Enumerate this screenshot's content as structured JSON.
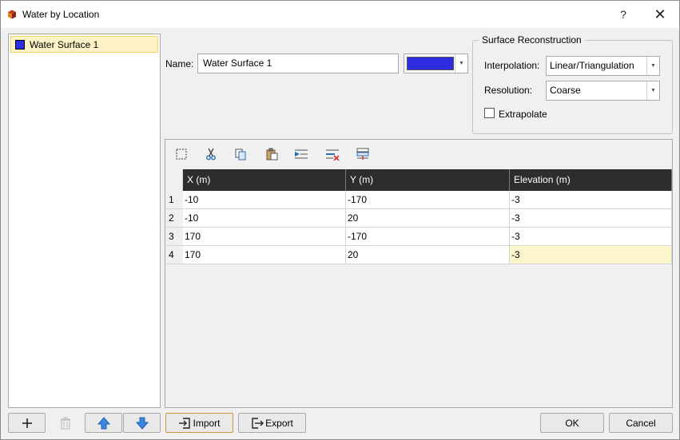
{
  "window": {
    "title": "Water by Location",
    "help_glyph": "?",
    "close_glyph": "✕"
  },
  "surfaces": {
    "items": [
      {
        "label": "Water Surface 1",
        "color": "#2e2ee0"
      }
    ]
  },
  "form": {
    "name_label": "Name:",
    "name_value": "Water Surface 1",
    "color": "#2e2ee0"
  },
  "reconstruction": {
    "title": "Surface Reconstruction",
    "interpolation_label": "Interpolation:",
    "interpolation_value": "Linear/Triangulation",
    "resolution_label": "Resolution:",
    "resolution_value": "Coarse",
    "extrapolate_label": "Extrapolate",
    "extrapolate_checked": false
  },
  "toolbar": {
    "icons": [
      "select-all-icon",
      "cut-icon",
      "copy-icon",
      "paste-icon",
      "insert-row-icon",
      "delete-row-icon",
      "append-row-icon"
    ]
  },
  "table": {
    "headers": [
      "X (m)",
      "Y (m)",
      "Elevation (m)"
    ],
    "rows": [
      {
        "n": "1",
        "x": "-10",
        "y": "-170",
        "z": "-3"
      },
      {
        "n": "2",
        "x": "-10",
        "y": "20",
        "z": "-3"
      },
      {
        "n": "3",
        "x": "170",
        "y": "-170",
        "z": "-3"
      },
      {
        "n": "4",
        "x": "170",
        "y": "20",
        "z": "-3"
      }
    ]
  },
  "footer": {
    "add_icon": "plus-icon",
    "delete_icon": "trash-icon",
    "up_icon": "arrow-up-icon",
    "down_icon": "arrow-down-icon",
    "import_label": "Import",
    "export_label": "Export",
    "ok_label": "OK",
    "cancel_label": "Cancel"
  }
}
